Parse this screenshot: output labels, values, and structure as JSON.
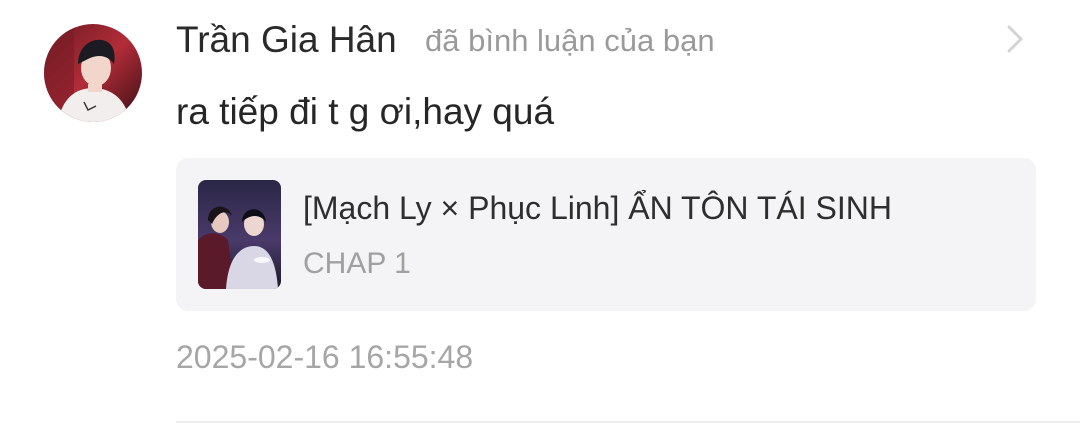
{
  "notification": {
    "user_name": "Trần Gia Hân",
    "action_text": "đã bình luận của bạn",
    "comment_text": "ra tiếp đi t g ơi,hay quá",
    "timestamp": "2025-02-16 16:55:48",
    "avatar_icon": "user-avatar-photo",
    "chevron_icon": "chevron-right-icon"
  },
  "story_card": {
    "title": "[Mạch Ly × Phục Linh] ẨN TÔN TÁI SINH",
    "chapter": "CHAP 1",
    "cover_icon": "story-cover-image"
  },
  "colors": {
    "card_background": "#f4f4f6",
    "secondary_text": "#9a9a9a",
    "primary_text": "#2a2a2a"
  }
}
